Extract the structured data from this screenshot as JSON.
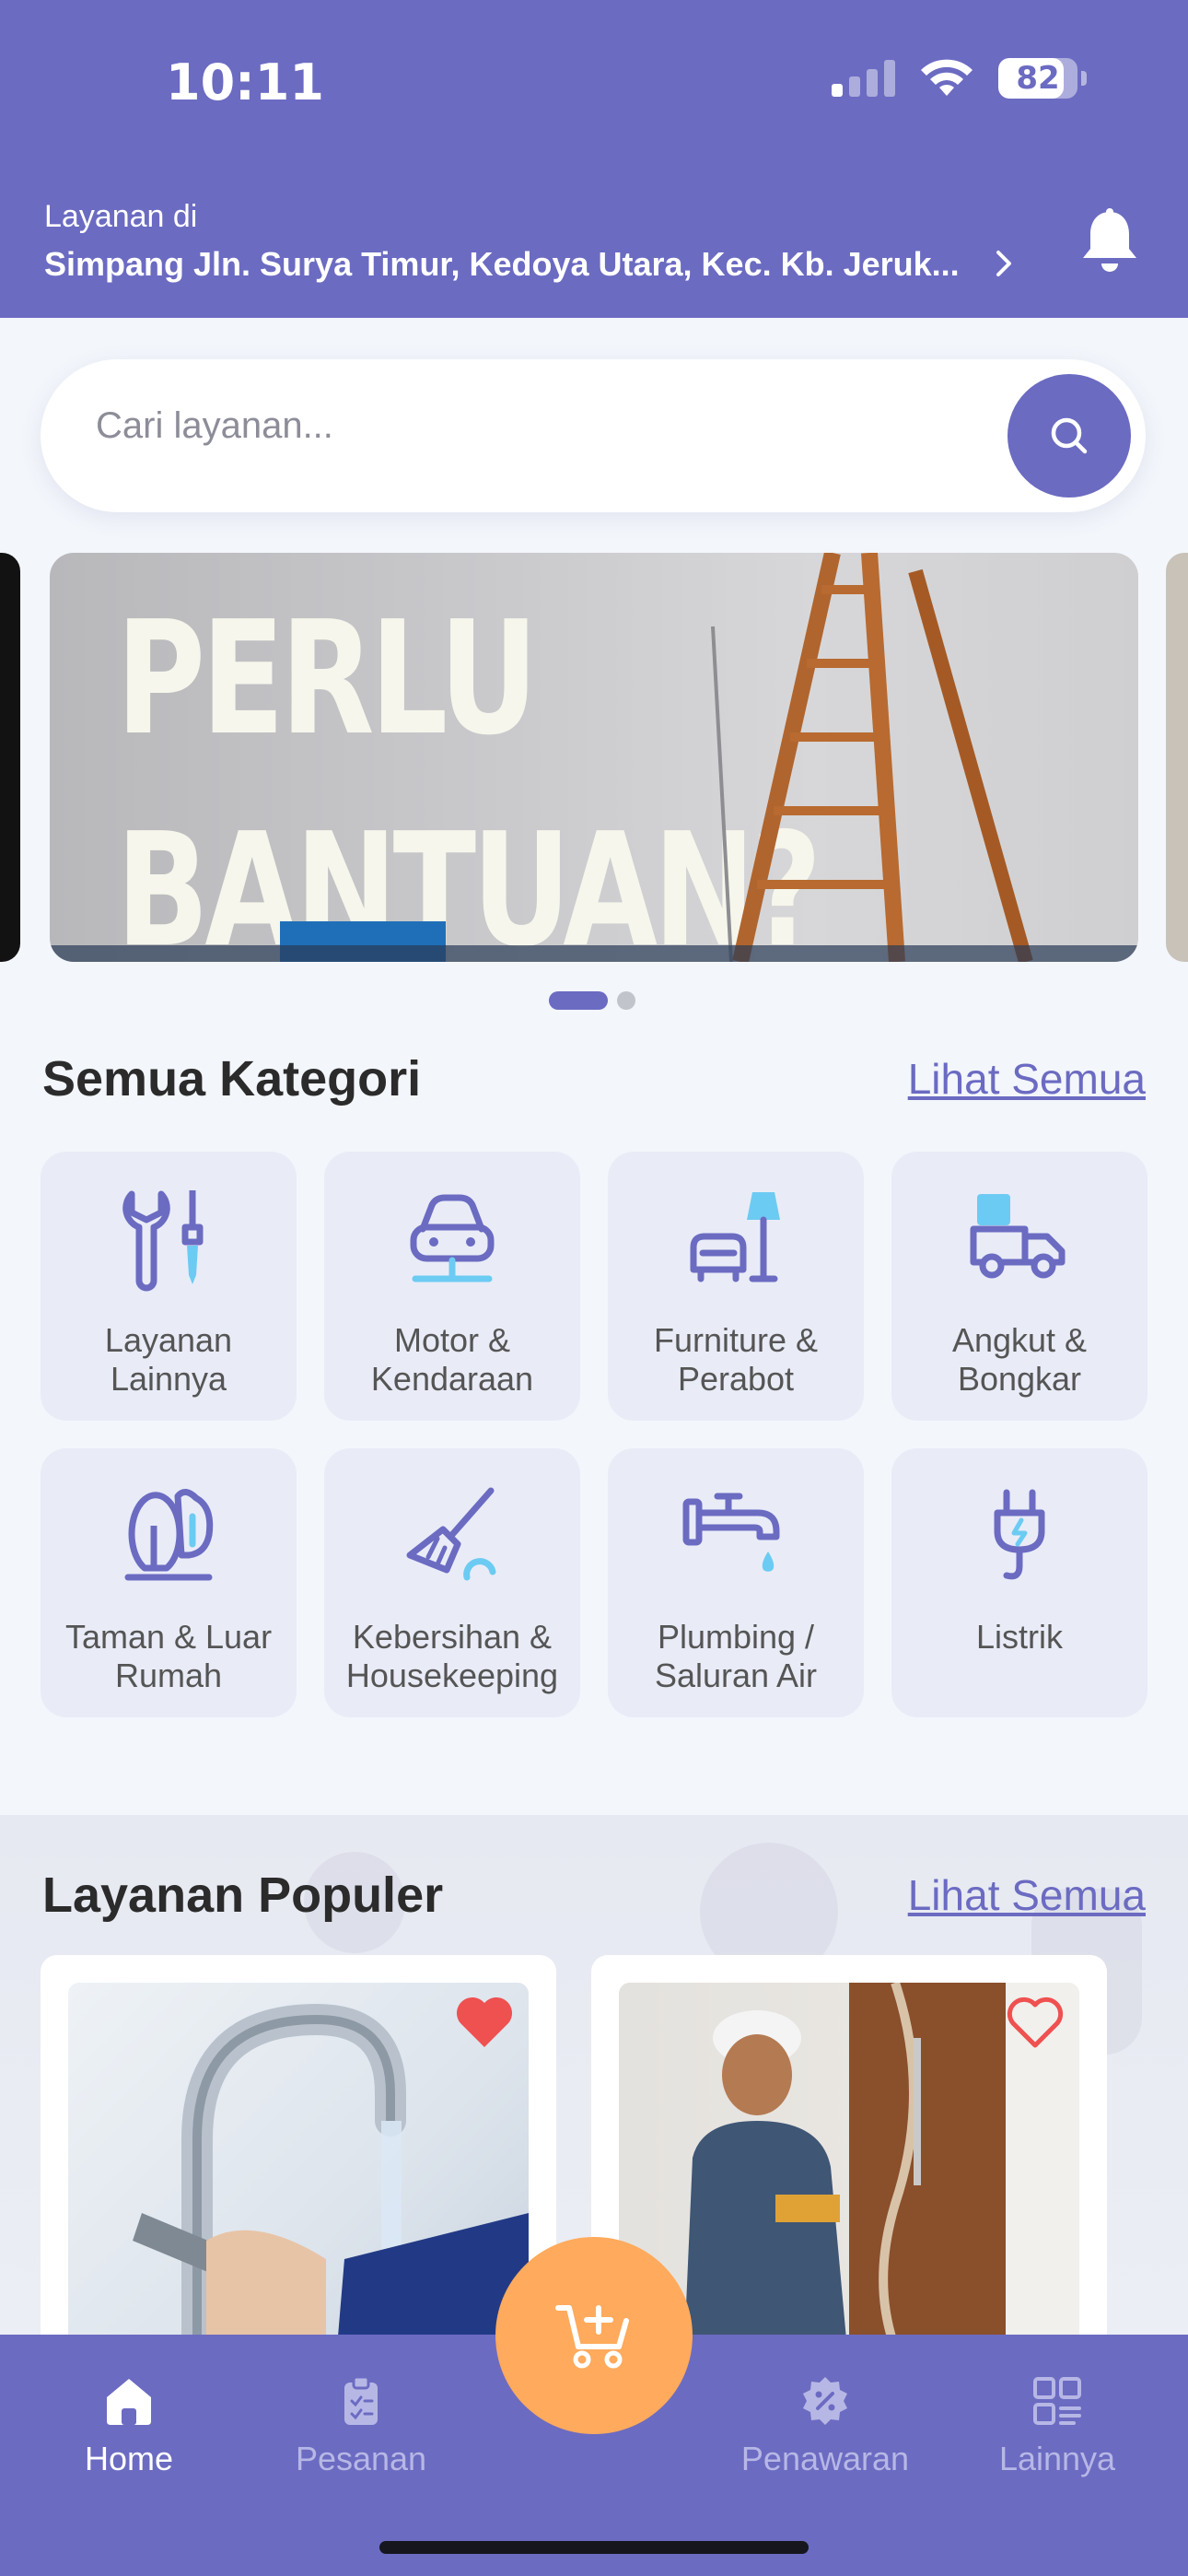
{
  "status_bar": {
    "time": "10:11",
    "battery": "82",
    "battery_level": 0.82,
    "signal_bars_active": 1,
    "icons": [
      "cellular-signal-icon",
      "wifi-icon",
      "battery-icon"
    ]
  },
  "header": {
    "location_label": "Layanan di",
    "location_address": "Simpang Jln. Surya Timur, Kedoya Utara, Kec. Kb. Jeruk...",
    "icons": [
      "chevron-right-icon",
      "bell-icon"
    ]
  },
  "search": {
    "placeholder": "Cari layanan...",
    "value": "",
    "icon": "search-icon"
  },
  "banner": {
    "title_line1": "PERLU",
    "title_line2": "BANTUAN?",
    "page_count": 2,
    "active_page": 1
  },
  "categories": {
    "title": "Semua Kategori",
    "see_all": "Lihat Semua",
    "items": [
      {
        "label": "Layanan\nLainnya",
        "icon": "tools-icon"
      },
      {
        "label": "Motor &\nKendaraan",
        "icon": "car-icon"
      },
      {
        "label": "Furniture &\nPerabot",
        "icon": "furniture-icon"
      },
      {
        "label": "Angkut &\nBongkar",
        "icon": "moving-truck-icon"
      },
      {
        "label": "Taman & Luar\nRumah",
        "icon": "tree-icon"
      },
      {
        "label": "Kebersihan &\nHousekeeping",
        "icon": "broom-icon"
      },
      {
        "label": "Plumbing /\nSaluran Air",
        "icon": "faucet-icon"
      },
      {
        "label": "Listrik",
        "icon": "plug-icon"
      }
    ]
  },
  "popular": {
    "title": "Layanan Populer",
    "see_all": "Lihat Semua",
    "cards": [
      {
        "image": "faucet-repair-photo",
        "favorited": true
      },
      {
        "image": "door-installation-photo",
        "favorited": false
      }
    ]
  },
  "bottom_nav": {
    "items": [
      {
        "label": "Home",
        "icon": "home-icon",
        "active": true
      },
      {
        "label": "Pesanan",
        "icon": "clipboard-icon",
        "active": false
      },
      {
        "label": "Penawaran",
        "icon": "discount-badge-icon",
        "active": false
      },
      {
        "label": "Lainnya",
        "icon": "grid-menu-icon",
        "active": false
      }
    ],
    "fab_icon": "cart-add-icon"
  },
  "colors": {
    "primary": "#6b6bc2",
    "accent_light": "#6ccbf2",
    "fab": "#ffaa5c",
    "heart": "#ef5050"
  }
}
